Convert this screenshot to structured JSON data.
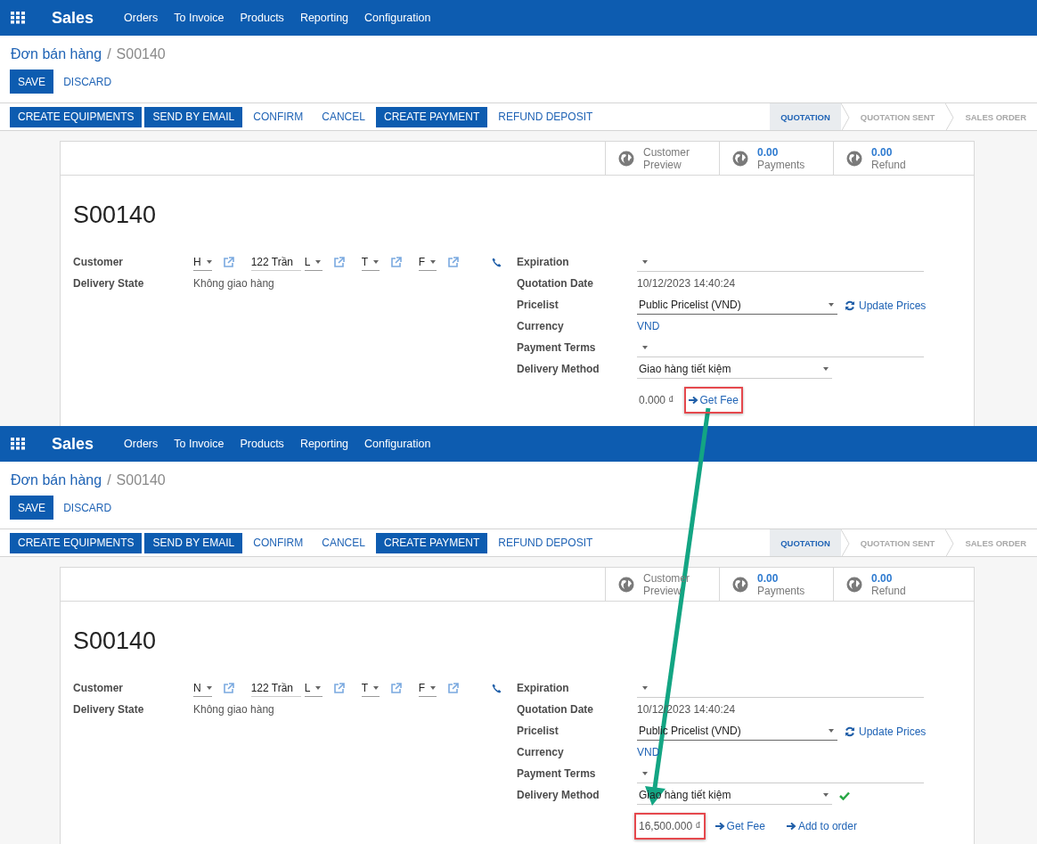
{
  "panels": [
    {
      "app": "Sales",
      "menu": [
        "Orders",
        "To Invoice",
        "Products",
        "Reporting",
        "Configuration"
      ],
      "breadcrumb": {
        "parent": "Đơn bán hàng",
        "separator": "/",
        "current": "S00140"
      },
      "edit_buttons": [
        {
          "label": "SAVE",
          "kind": "primary"
        },
        {
          "label": "DISCARD",
          "kind": "link"
        }
      ],
      "actions": [
        {
          "label": "CREATE EQUIPMENTS",
          "kind": "primary"
        },
        {
          "label": "SEND BY EMAIL",
          "kind": "primary"
        },
        {
          "label": "CONFIRM",
          "kind": "link"
        },
        {
          "label": "CANCEL",
          "kind": "link"
        },
        {
          "label": "CREATE PAYMENT",
          "kind": "primary"
        },
        {
          "label": "REFUND DEPOSIT",
          "kind": "link"
        }
      ],
      "stages": [
        {
          "label": "QUOTATION",
          "selected": true
        },
        {
          "label": "QUOTATION SENT",
          "selected": false
        },
        {
          "label": "SALES ORDER",
          "selected": false
        }
      ],
      "stat_buttons": [
        {
          "label": "Customer Preview"
        },
        {
          "value": "0.00",
          "label": "Payments"
        },
        {
          "value": "0.00",
          "label": "Refund"
        }
      ],
      "order_name": "S00140",
      "customer": {
        "label": "Customer",
        "parts": [
          {
            "kind": "dropdown",
            "value": "H"
          },
          {
            "kind": "open-link"
          },
          {
            "kind": "text",
            "value": "122 Trần"
          },
          {
            "kind": "dropdown",
            "value": "L"
          },
          {
            "kind": "open-link"
          },
          {
            "kind": "dropdown",
            "value": "T"
          },
          {
            "kind": "open-link"
          },
          {
            "kind": "dropdown",
            "value": "F"
          },
          {
            "kind": "open-link"
          },
          {
            "kind": "phone"
          }
        ]
      },
      "delivery_state": {
        "label": "Delivery State",
        "value": "Không giao hàng"
      },
      "right_fields": [
        {
          "label": "Expiration",
          "kind": "dropdown"
        },
        {
          "label": "Quotation Date",
          "kind": "text",
          "value": "10/12/2023 14:40:24"
        },
        {
          "label": "Pricelist",
          "kind": "dropdown",
          "value": "Public Pricelist (VND)",
          "action": "Update Prices"
        },
        {
          "label": "Currency",
          "kind": "link",
          "value": "VND"
        },
        {
          "label": "Payment Terms",
          "kind": "dropdown"
        },
        {
          "label": "Delivery Method",
          "kind": "dropdown",
          "value": "Giao hàng tiết kiệm",
          "confirmed": false
        }
      ],
      "fee": {
        "amount": "0.000 ₫",
        "highlighted": false,
        "links": [
          {
            "label": "Get Fee",
            "highlighted": true
          }
        ]
      }
    },
    {
      "app": "Sales",
      "menu": [
        "Orders",
        "To Invoice",
        "Products",
        "Reporting",
        "Configuration"
      ],
      "breadcrumb": {
        "parent": "Đơn bán hàng",
        "separator": "/",
        "current": "S00140"
      },
      "edit_buttons": [
        {
          "label": "SAVE",
          "kind": "primary"
        },
        {
          "label": "DISCARD",
          "kind": "link"
        }
      ],
      "actions": [
        {
          "label": "CREATE EQUIPMENTS",
          "kind": "primary"
        },
        {
          "label": "SEND BY EMAIL",
          "kind": "primary"
        },
        {
          "label": "CONFIRM",
          "kind": "link"
        },
        {
          "label": "CANCEL",
          "kind": "link"
        },
        {
          "label": "CREATE PAYMENT",
          "kind": "primary"
        },
        {
          "label": "REFUND DEPOSIT",
          "kind": "link"
        }
      ],
      "stages": [
        {
          "label": "QUOTATION",
          "selected": true
        },
        {
          "label": "QUOTATION SENT",
          "selected": false
        },
        {
          "label": "SALES ORDER",
          "selected": false
        }
      ],
      "stat_buttons": [
        {
          "label": "Customer Preview"
        },
        {
          "value": "0.00",
          "label": "Payments"
        },
        {
          "value": "0.00",
          "label": "Refund"
        }
      ],
      "order_name": "S00140",
      "customer": {
        "label": "Customer",
        "parts": [
          {
            "kind": "dropdown",
            "value": "N"
          },
          {
            "kind": "open-link"
          },
          {
            "kind": "text",
            "value": "122 Trần"
          },
          {
            "kind": "dropdown",
            "value": "L"
          },
          {
            "kind": "open-link"
          },
          {
            "kind": "dropdown",
            "value": "T"
          },
          {
            "kind": "open-link"
          },
          {
            "kind": "dropdown",
            "value": "F"
          },
          {
            "kind": "open-link"
          },
          {
            "kind": "phone"
          }
        ]
      },
      "delivery_state": {
        "label": "Delivery State",
        "value": "Không giao hàng"
      },
      "right_fields": [
        {
          "label": "Expiration",
          "kind": "dropdown"
        },
        {
          "label": "Quotation Date",
          "kind": "text",
          "value": "10/12/2023 14:40:24"
        },
        {
          "label": "Pricelist",
          "kind": "dropdown",
          "value": "Public Pricelist (VND)",
          "action": "Update Prices"
        },
        {
          "label": "Currency",
          "kind": "link",
          "value": "VND"
        },
        {
          "label": "Payment Terms",
          "kind": "dropdown"
        },
        {
          "label": "Delivery Method",
          "kind": "dropdown",
          "value": "Giao hàng tiết kiệm",
          "confirmed": true
        }
      ],
      "fee": {
        "amount": "16,500.000 ₫",
        "highlighted": true,
        "links": [
          {
            "label": "Get Fee",
            "highlighted": false
          },
          {
            "label": "Add to order",
            "highlighted": false
          }
        ]
      }
    }
  ]
}
